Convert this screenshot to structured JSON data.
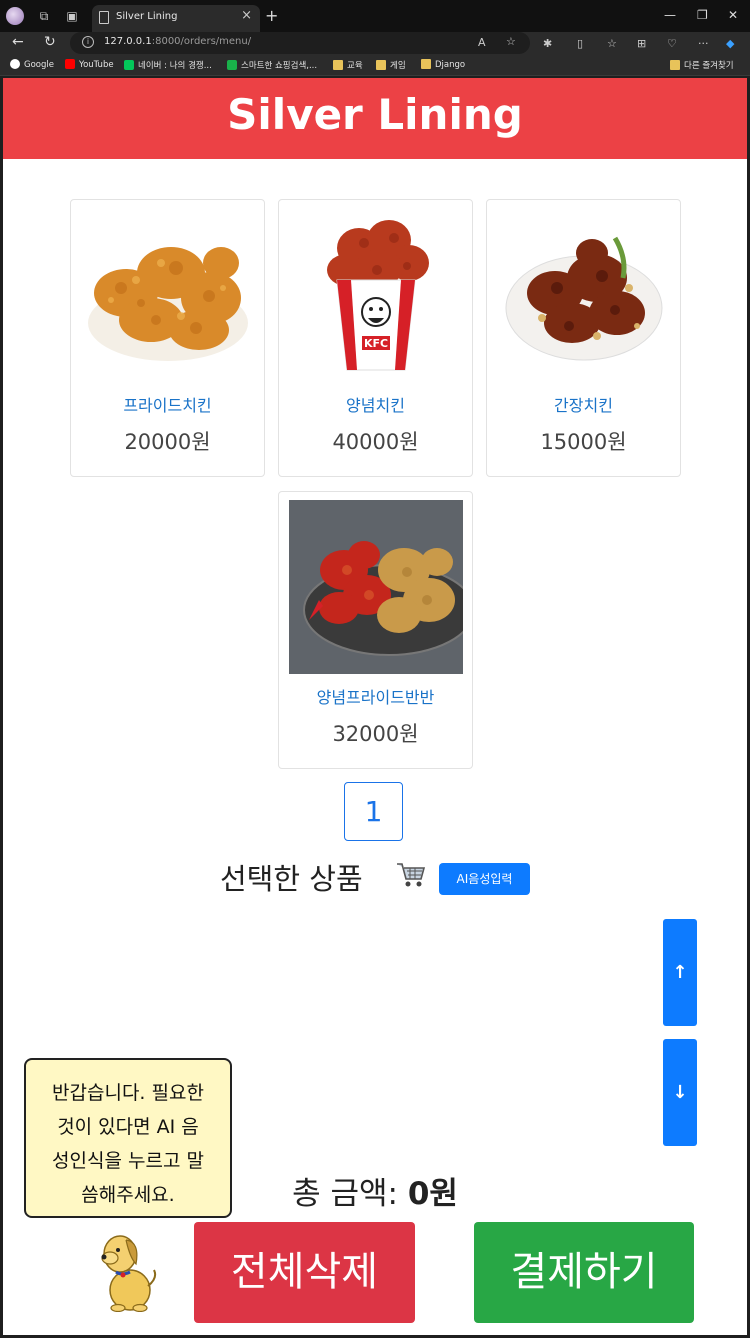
{
  "browser": {
    "tab_title": "Silver Lining",
    "url_host": "127.0.0.1",
    "url_rest": ":8000/orders/menu/",
    "bookmarks": [
      {
        "label": "Google"
      },
      {
        "label": "YouTube"
      },
      {
        "label": "네이버 : 나의 경쟁..."
      },
      {
        "label": "스마트한 쇼핑검색,..."
      },
      {
        "label": "교육"
      },
      {
        "label": "게임"
      },
      {
        "label": "Django"
      }
    ],
    "other_bookmarks": "다른 즐겨찾기"
  },
  "site": {
    "title": "Silver Lining",
    "header_color": "#ec4145"
  },
  "menu": [
    {
      "name": "프라이드치킨",
      "price": "20000원"
    },
    {
      "name": "양념치킨",
      "price": "40000원"
    },
    {
      "name": "간장치킨",
      "price": "15000원"
    },
    {
      "name": "양념프라이드반반",
      "price": "32000원"
    }
  ],
  "pagination": {
    "current": "1"
  },
  "cart": {
    "title": "선택한 상품",
    "ai_button": "AI음성입력",
    "total_label": "총 금액:",
    "total_value": "0원"
  },
  "assistant": {
    "line1": "반갑습니다. 필요한",
    "line2": "것이 있다면 AI 음",
    "line3": "성인식을 누르고 말",
    "line4": "씀해주세요."
  },
  "actions": {
    "delete_all": "전체삭제",
    "checkout": "결제하기"
  }
}
